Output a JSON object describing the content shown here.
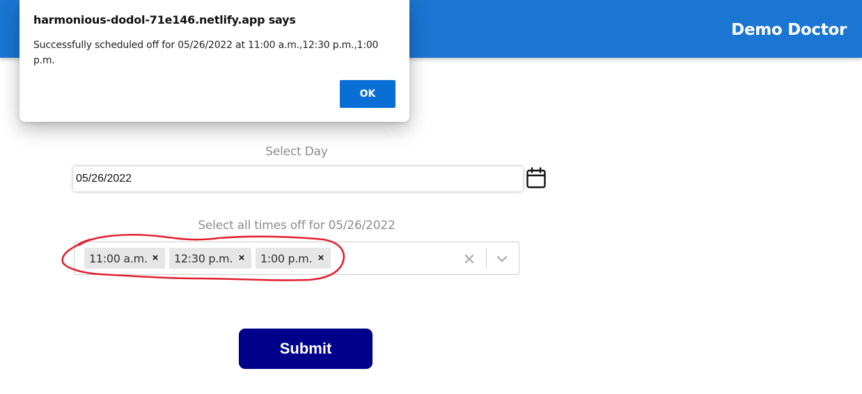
{
  "header": {
    "title": "Demo Doctor",
    "color": "#1a76d2"
  },
  "dialog": {
    "title": "harmonious-dodol-71e146.netlify.app says",
    "message": "Successfully scheduled off for 05/26/2022 at 11:00 a.m.,12:30 p.m.,1:00 p.m.",
    "ok_label": "OK",
    "ok_color": "#0a6fd4"
  },
  "form": {
    "day_label": "Select Day",
    "date_value": "05/26/2022",
    "calendar_icon": "calendar-icon",
    "times_label": "Select all times off for 05/26/2022",
    "selected_times": [
      {
        "label": "11:00 a.m.",
        "remove": "×"
      },
      {
        "label": "12:30 p.m.",
        "remove": "×"
      },
      {
        "label": "1:00 p.m.",
        "remove": "×"
      }
    ],
    "clear_icon": "clear-icon",
    "dropdown_icon": "chevron-down-icon",
    "submit_label": "Submit",
    "submit_color": "#00008b",
    "annotation_color": "#e0202e"
  }
}
